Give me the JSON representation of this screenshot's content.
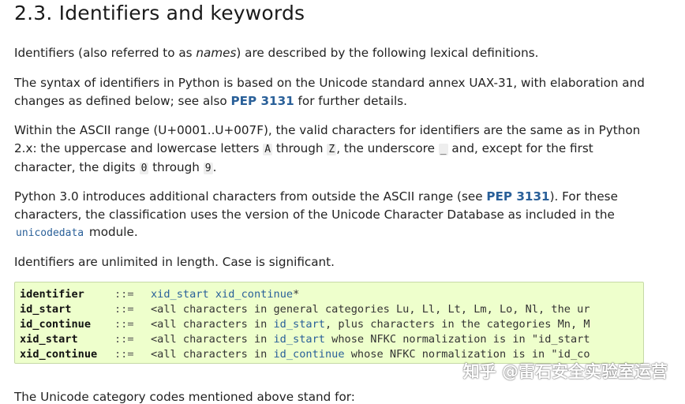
{
  "heading": "2.3. Identifiers and keywords",
  "p1": {
    "before": "Identifiers (also referred to as ",
    "em": "names",
    "after": ") are described by the following lexical definitions."
  },
  "p2": {
    "before": "The syntax of identifiers in Python is based on the Unicode standard annex UAX-31, with elaboration and changes as defined below; see also ",
    "link": "PEP 3131",
    "after": " for further details."
  },
  "p3": {
    "t1": "Within the ASCII range (U+0001..U+007F), the valid characters for identifiers are the same as in Python 2.x: the uppercase and lowercase letters ",
    "c1": "A",
    "t2": " through ",
    "c2": "Z",
    "t3": ", the underscore ",
    "c3": "_",
    "t4": " and, except for the first character, the digits ",
    "c4": "0",
    "t5": " through ",
    "c5": "9",
    "t6": "."
  },
  "p4": {
    "t1": "Python 3.0 introduces additional characters from outside the ASCII range (see ",
    "link": "PEP 3131",
    "t2": "). For these characters, the classification uses the version of the Unicode Character Database as included in the ",
    "module": "unicodedata",
    "t3": " module."
  },
  "p5": "Identifiers are unlimited in length. Case is significant.",
  "grammar": [
    {
      "name": "identifier",
      "op": "::=",
      "tok1": "xid_start",
      "sp": " ",
      "tok2": "xid_continue",
      "rest": "*"
    },
    {
      "name": "id_start",
      "op": "::=",
      "pre": "<all characters in general categories Lu, Ll, Lt, Lm, Lo, Nl, the ur"
    },
    {
      "name": "id_continue",
      "op": "::=",
      "pre": "<all characters in ",
      "tok": "id_start",
      "post": ", plus characters in the categories Mn, M"
    },
    {
      "name": "xid_start",
      "op": "::=",
      "pre": "<all characters in ",
      "tok": "id_start",
      "post": " whose NFKC normalization is in \"id_start"
    },
    {
      "name": "xid_continue",
      "op": "::=",
      "pre": "<all characters in ",
      "tok": "id_continue",
      "post": " whose NFKC normalization is in \"id_co"
    }
  ],
  "watermark": "知乎 @雷石安全实验室运营",
  "cutoff_text": "The Unicode category codes mentioned above stand for:",
  "colors": {
    "link": "#2a6099",
    "grammar_bg": "#eeffcc",
    "grammar_border": "#c6d9a6"
  }
}
